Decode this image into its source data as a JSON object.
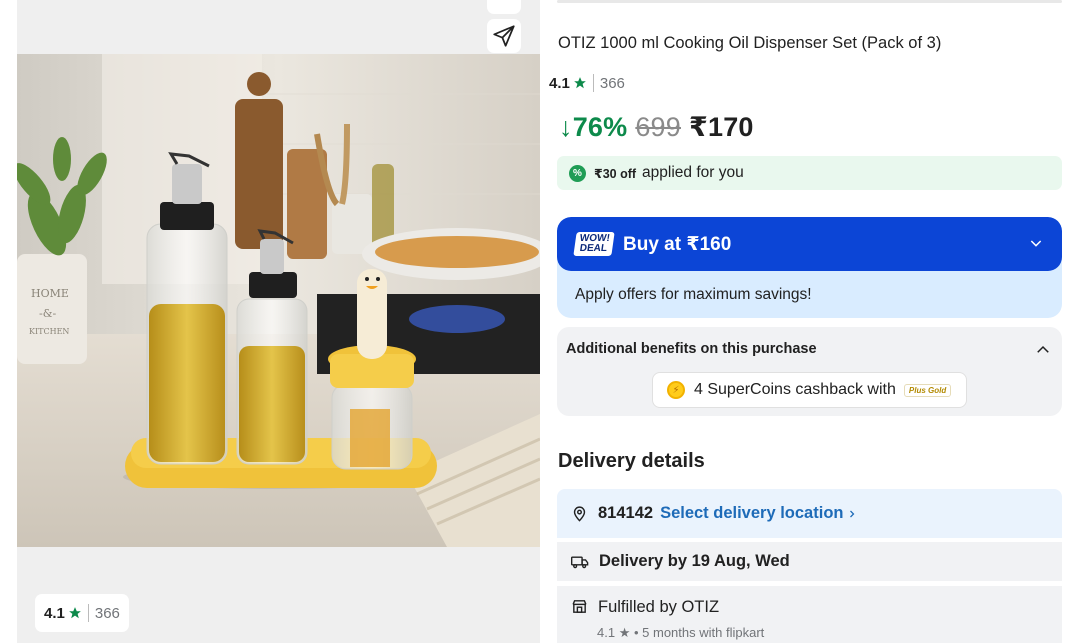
{
  "product": {
    "title": "OTIZ 1000 ml Cooking Oil Dispenser Set (Pack of 3)",
    "rating": "4.1",
    "rating_count": "366",
    "discount": "↓76%",
    "mrp": "699",
    "price": "₹170"
  },
  "gallery": {
    "share_icon": "send-icon",
    "rating": "4.1",
    "rating_count": "366",
    "photo_label": "HOME & KITCHEN"
  },
  "offer": {
    "applied_amount": "₹30 off",
    "applied_text": "applied for you"
  },
  "deal": {
    "badge": "WOW! DEAL",
    "label": "Buy at ₹160",
    "sub": "Apply offers for maximum savings!",
    "color": "#0c45d6"
  },
  "benefits": {
    "heading": "Additional benefits on this purchase",
    "supercoins": "4 SuperCoins cashback with",
    "plus": "Plus Gold"
  },
  "delivery": {
    "heading": "Delivery details",
    "pincode": "814142",
    "select_location": "Select delivery location",
    "by": "Delivery by 19 Aug, Wed",
    "fulfilled": "Fulfilled by OTIZ",
    "seller_rating": "4.1",
    "seller_meta": "5 months with flipkart"
  },
  "colors": {
    "discount_green": "#0d8a4b",
    "link_blue": "#1e6bb8"
  }
}
